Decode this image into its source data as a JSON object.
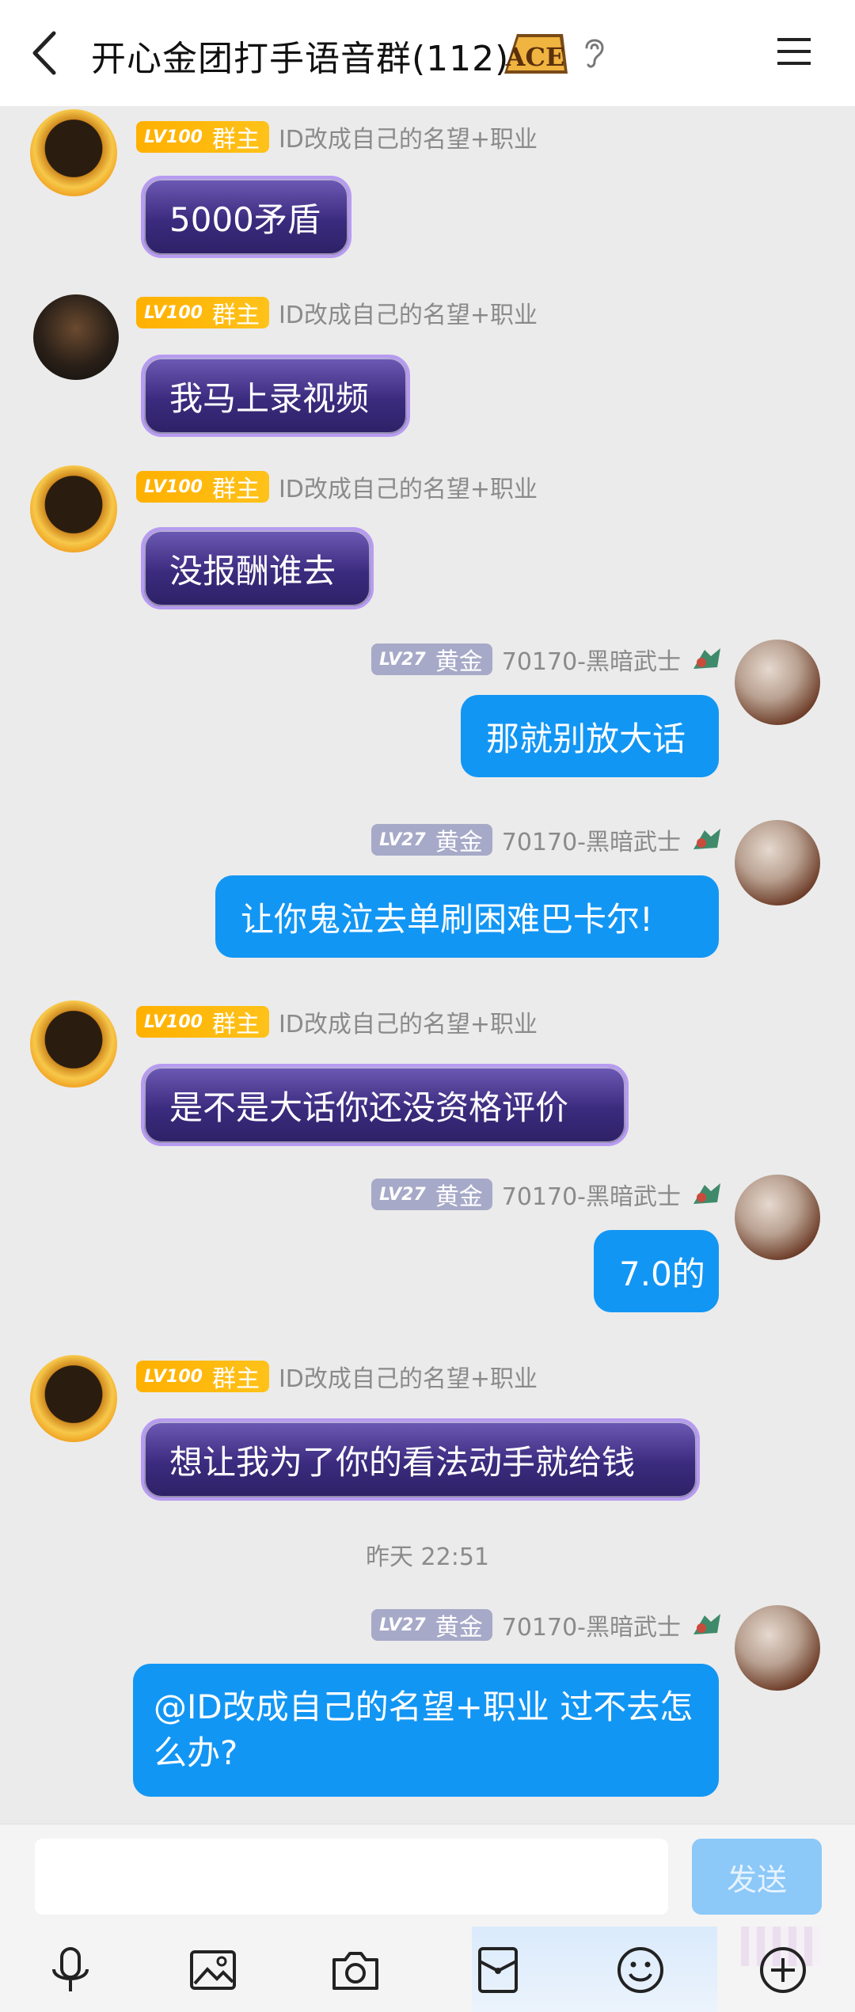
{
  "header": {
    "title": "开心金团打手语音群(112)",
    "ace_badge": "ACE",
    "back_icon": "chevron-left-icon",
    "ear_icon": "ear-icon",
    "menu_icon": "hamburger-menu-icon"
  },
  "senders": {
    "owner": {
      "level": "LV100",
      "role": "群主",
      "nickname": "ID改成自己的名望+职业"
    },
    "me": {
      "level": "LV27",
      "role": "黄金",
      "nickname": "70170-黑暗武士"
    }
  },
  "messages": [
    {
      "text": "5000矛盾"
    },
    {
      "text": "我马上录视频"
    },
    {
      "text": "没报酬谁去"
    },
    {
      "text": "那就别放大话"
    },
    {
      "text": "让你鬼泣去单刷困难巴卡尔!"
    },
    {
      "text": "是不是大话你还没资格评价"
    },
    {
      "text": "7.0的"
    },
    {
      "text": "想让我为了你的看法动手就给钱"
    },
    {
      "text": "@ID改成自己的名望+职业 过不去怎么办?"
    }
  ],
  "timestamp": "昨天 22:51",
  "input": {
    "placeholder": "",
    "send_label": "发送"
  },
  "toolbar": {
    "icons": [
      "microphone-icon",
      "image-icon",
      "camera-icon",
      "red-packet-icon",
      "emoji-icon",
      "plus-icon"
    ]
  },
  "colors": {
    "blue_bubble": "#1296f4",
    "purple_bubble": "#3b2b7e",
    "owner_badge": "#ffb000",
    "gold_badge": "#a7a9c8",
    "send_disabled": "#8cc8f8"
  }
}
